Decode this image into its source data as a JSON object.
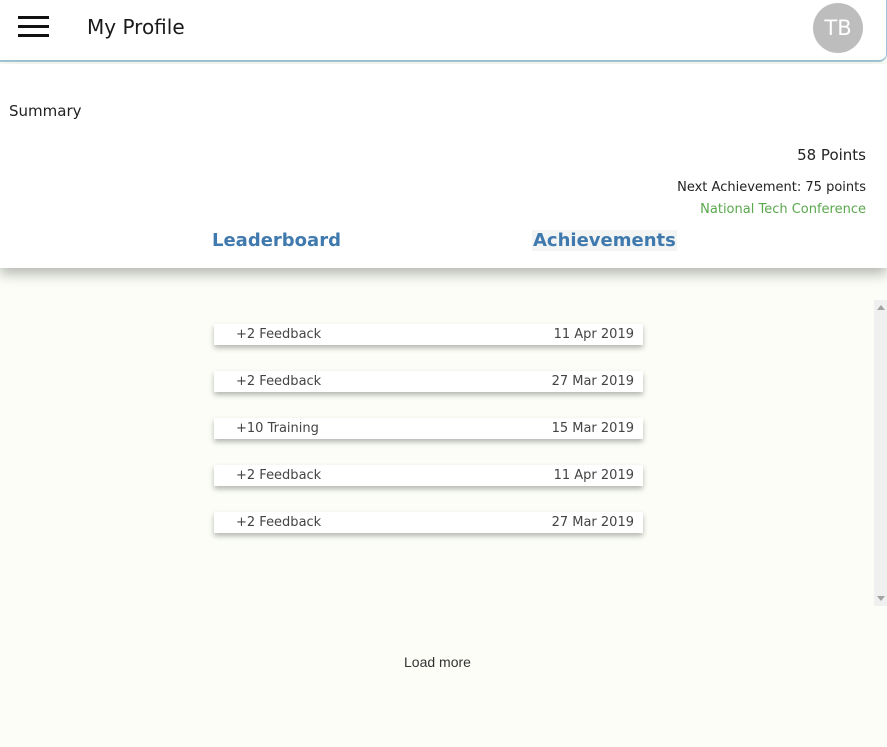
{
  "header": {
    "title": "My Profile",
    "avatar_initials": "TB",
    "menu_icon": "hamburger-menu-icon"
  },
  "summary": {
    "label": "Summary",
    "points": "58 Points",
    "next_achievement": "Next Achievement: 75 points",
    "achievement_name": "National Tech Conference",
    "achievement_color": "#5aa84d"
  },
  "tabs": [
    {
      "label": "Leaderboard"
    },
    {
      "label": "Achievements"
    }
  ],
  "activity": [
    {
      "description": "+2 Feedback",
      "date": "11 Apr 2019"
    },
    {
      "description": "+2 Feedback",
      "date": "27 Mar 2019"
    },
    {
      "description": "+10 Training",
      "date": "15 Mar 2019"
    },
    {
      "description": "+2 Feedback",
      "date": "11 Apr 2019"
    },
    {
      "description": "+2 Feedback",
      "date": "27 Mar 2019"
    }
  ],
  "load_more_label": "Load more",
  "colors": {
    "tab_text": "#3f79ad",
    "background": "#fbfdf6"
  }
}
